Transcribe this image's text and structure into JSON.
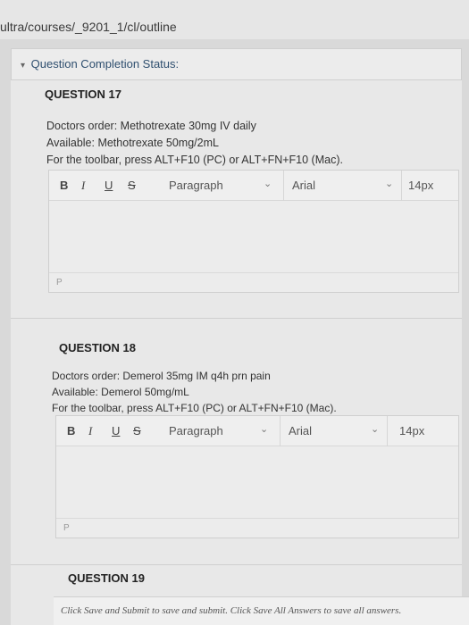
{
  "url": "ultra/courses/_9201_1/cl/outline",
  "status": {
    "label": "Question Completion Status:"
  },
  "toolbar": {
    "bold": "B",
    "italic": "I",
    "underline": "U",
    "strike": "S",
    "format": "Paragraph",
    "font": "Arial",
    "size": "14px"
  },
  "questions": [
    {
      "title": "QUESTION 17",
      "lines": [
        "Doctors order:  Methotrexate 30mg IV daily",
        "Available:  Methotrexate 50mg/2mL",
        "For the toolbar, press ALT+F10 (PC) or ALT+FN+F10 (Mac)."
      ],
      "path": "P"
    },
    {
      "title": "QUESTION 18",
      "lines": [
        "Doctors order:  Demerol 35mg IM q4h prn pain",
        "Available:  Demerol 50mg/mL",
        "For the toolbar, press ALT+F10 (PC) or ALT+FN+F10 (Mac)."
      ],
      "path": "P"
    },
    {
      "title": "QUESTION 19"
    }
  ],
  "footer": "Click Save and Submit to save and submit. Click Save All Answers to save all answers."
}
